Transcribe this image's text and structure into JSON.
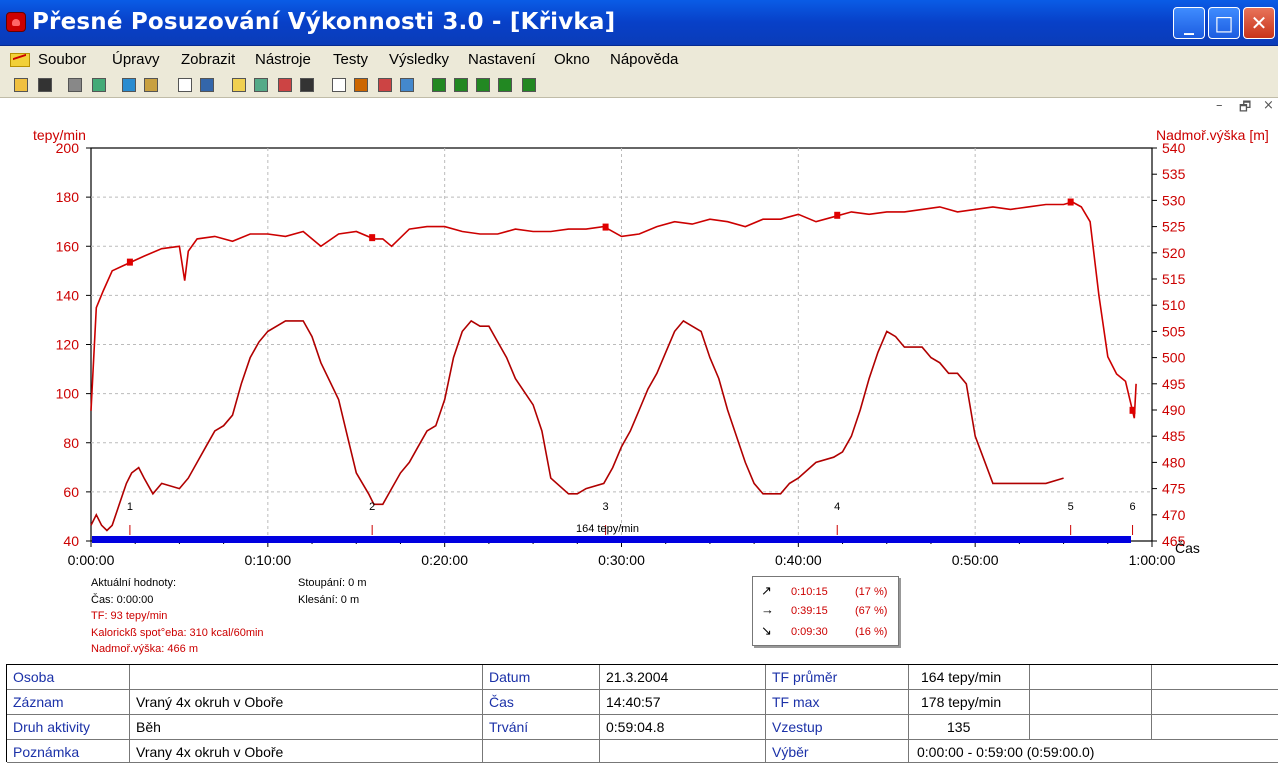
{
  "window": {
    "title": "Přesné Posuzování Výkonnosti 3.0 - [Křivka]",
    "min_glyph": "_",
    "max_glyph": "□",
    "close_glyph": "✕"
  },
  "menu": {
    "items": [
      "Soubor",
      "Úpravy",
      "Zobrazit",
      "Nástroje",
      "Testy",
      "Výsledky",
      "Nastavení",
      "Okno",
      "Nápověda"
    ],
    "mdi_min": "–",
    "mdi_restore": "🗗",
    "mdi_close": "×"
  },
  "toolbar": {
    "icons": [
      "open-icon",
      "save-icon",
      "print-icon",
      "copy-icon",
      "globe-icon",
      "wand-icon",
      "table-icon",
      "book-icon",
      "area-chart-icon",
      "bar-chart-icon",
      "percent-chart-icon",
      "grid-chart-icon",
      "zoom-icon",
      "curve-icon",
      "marker-icon",
      "line-chart-icon",
      "bar-1-icon",
      "bar-2-icon",
      "bar-3-icon",
      "bar-4-icon",
      "bar-5-icon"
    ]
  },
  "chart_data": {
    "type": "line",
    "ylabel": "tepy/min",
    "y2label": "Nadmoř.výška [m]",
    "xlabel": "Čas",
    "ylim": [
      40,
      200
    ],
    "y2lim": [
      465,
      540
    ],
    "xlim_minutes": [
      0,
      60
    ],
    "y_ticks": [
      "40",
      "60",
      "80",
      "100",
      "120",
      "140",
      "160",
      "180",
      "200"
    ],
    "y2_ticks": [
      "465",
      "470",
      "475",
      "480",
      "485",
      "490",
      "495",
      "500",
      "505",
      "510",
      "515",
      "520",
      "525",
      "530",
      "535",
      "540"
    ],
    "x_ticks": [
      "0:00:00",
      "0:10:00",
      "0:20:00",
      "0:30:00",
      "0:40:00",
      "0:50:00",
      "1:00:00"
    ],
    "grid": true,
    "series": [
      {
        "name": "TF",
        "axis": "left",
        "color": "#cc0000",
        "minutes": [
          0,
          0.3,
          0.7,
          1.2,
          1.8,
          2.4,
          3,
          4,
          5,
          5.3,
          5.5,
          6,
          7,
          8,
          9,
          10,
          11,
          12,
          13,
          14,
          15,
          16,
          16.5,
          17,
          18,
          19,
          20,
          21,
          22,
          23,
          24,
          25,
          26,
          27,
          28,
          29,
          30,
          31,
          32,
          33,
          34,
          35,
          36,
          37,
          38,
          39,
          40,
          41,
          42,
          43,
          44,
          45,
          46,
          47,
          48,
          49,
          50,
          51,
          52,
          53,
          54,
          55,
          55.5,
          56,
          56.5,
          57,
          57.5,
          58,
          58.5,
          59,
          59.1
        ],
        "values": [
          93,
          135,
          142,
          150,
          152,
          154,
          156,
          159,
          160,
          146,
          158,
          163,
          164,
          162,
          165,
          165,
          164,
          166,
          160,
          165,
          166,
          163,
          163,
          160,
          167,
          168,
          168,
          166,
          165,
          165,
          167,
          166,
          166,
          167,
          167,
          168,
          164,
          165,
          168,
          170,
          169,
          171,
          170,
          168,
          171,
          171,
          173,
          170,
          172,
          174,
          173,
          174,
          174,
          175,
          176,
          174,
          175,
          176,
          175,
          176,
          177,
          177,
          178,
          176,
          170,
          140,
          115,
          108,
          105,
          90,
          104
        ]
      },
      {
        "name": "Nadmoř.výška",
        "axis": "right",
        "color": "#b00000",
        "minutes": [
          0,
          0.3,
          0.6,
          0.9,
          1.2,
          1.6,
          2,
          2.3,
          2.7,
          3,
          3.5,
          4,
          5,
          5.5,
          6,
          6.5,
          7,
          7.5,
          8,
          8.5,
          9,
          9.5,
          10,
          11,
          12,
          12.5,
          13,
          14,
          14.5,
          15,
          15.7,
          16,
          16.5,
          17,
          17.5,
          18,
          18.5,
          19,
          19.5,
          20,
          20.5,
          21,
          21.5,
          22,
          22.5,
          23,
          23.5,
          24,
          25,
          25.5,
          26,
          27,
          27.5,
          28,
          29,
          29.5,
          30,
          30.5,
          31,
          31.5,
          32,
          32.5,
          33,
          33.5,
          34,
          34.5,
          35,
          35.5,
          36,
          37,
          37.5,
          38,
          39,
          39.5,
          40,
          41,
          42,
          42.5,
          43,
          43.5,
          44,
          44.5,
          45,
          45.5,
          46,
          46.5,
          47,
          47.5,
          48,
          48.5,
          49,
          49.5,
          50,
          51,
          52,
          53,
          54,
          55,
          55.5,
          56,
          56.5,
          57,
          58,
          59,
          59.1
        ],
        "values": [
          468,
          470,
          468,
          467,
          468,
          472,
          476,
          478,
          479,
          477,
          474,
          476,
          475,
          477,
          480,
          483,
          486,
          487,
          489,
          495,
          500,
          503,
          505,
          507,
          507,
          504,
          499,
          492,
          485,
          478,
          474,
          472,
          472,
          475,
          478,
          480,
          483,
          486,
          487,
          492,
          500,
          505,
          507,
          506,
          506,
          503,
          500,
          496,
          491,
          486,
          477,
          474,
          474,
          475,
          476,
          479,
          483,
          486,
          490,
          494,
          497,
          501,
          505,
          507,
          506,
          505,
          500,
          496,
          490,
          480,
          476,
          474,
          474,
          476,
          477,
          480,
          481,
          482,
          485,
          490,
          496,
          501,
          505,
          504,
          502,
          502,
          502,
          500,
          499,
          497,
          497,
          495,
          485,
          476,
          476,
          476,
          476,
          477
        ]
      }
    ],
    "markers": [
      {
        "label": "1",
        "minute": 2.2
      },
      {
        "label": "2",
        "minute": 15.9
      },
      {
        "label": "3",
        "minute": 29.1
      },
      {
        "label": "4",
        "minute": 42.2
      },
      {
        "label": "5",
        "minute": 55.4
      },
      {
        "label": "6",
        "minute": 58.9
      }
    ],
    "bar_label": "164 tepy/min"
  },
  "info": {
    "title": "Aktuální hodnoty:",
    "cas": "Čas: 0:00:00",
    "tf": "TF: 93 tepy/min",
    "kal": "Kalorickß spot°eba: 310 kcal/60min",
    "vyska": "Nadmoř.výška: 466 m",
    "stoupani": "Stoupání: 0 m",
    "klesani": "Klesání: 0 m"
  },
  "stats": [
    {
      "arrow": "↗",
      "time": "0:10:15",
      "pct": "(17 %)"
    },
    {
      "arrow": "→",
      "time": "0:39:15",
      "pct": "(67 %)"
    },
    {
      "arrow": "↘",
      "time": "0:09:30",
      "pct": "(16 %)"
    }
  ],
  "table": {
    "osoba": "Osoba",
    "osoba_val": "",
    "zaznam": "Záznam",
    "zaznam_val": "Vraný 4x okruh v Oboře",
    "druh": "Druh aktivity",
    "druh_val": "Běh",
    "poznamka": "Poznámka",
    "poznamka_val": "Vrany 4x okruh v Oboře",
    "datum": "Datum",
    "datum_val": "21.3.2004",
    "cas": "Čas",
    "cas_val": "14:40:57",
    "trvani": "Trvání",
    "trvani_val": "0:59:04.8",
    "tfp": "TF průměr",
    "tfp_val": "164 tepy/min",
    "tfmax": "TF max",
    "tfmax_val": "178 tepy/min",
    "vzestup": "Vzestup",
    "vzestup_val": "135",
    "vyber": "Výběr",
    "vyber_val": "0:00:00 - 0:59:00 (0:59:00.0)"
  }
}
